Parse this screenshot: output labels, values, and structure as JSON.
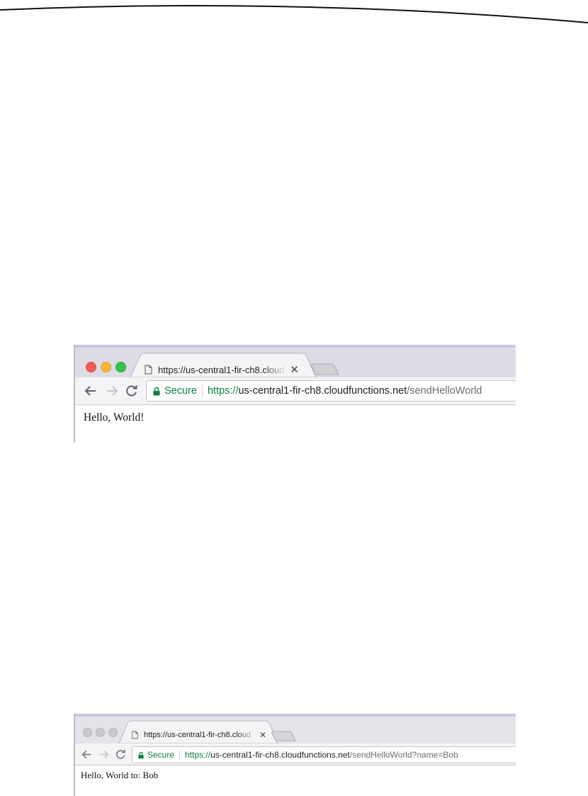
{
  "screenshots": [
    {
      "tab": {
        "title": "https://us-central1-fir-ch8.cloud",
        "close": "✕",
        "icon": "page-icon"
      },
      "address_bar": {
        "secure_label": "Secure",
        "url_scheme": "https://",
        "url_host": "us-central1-fir-ch8.cloudfunctions.net",
        "url_path": "/sendHelloWorld"
      },
      "page": {
        "text": "Hello, World!"
      }
    },
    {
      "tab": {
        "title": "https://us-central1-fir-ch8.cloud",
        "close": "✕",
        "icon": "page-icon"
      },
      "address_bar": {
        "secure_label": "Secure",
        "url_scheme": "https://",
        "url_host": "us-central1-fir-ch8.cloudfunctions.net",
        "url_path": "/sendHelloWorld?name=Bob"
      },
      "page": {
        "text": "Hello, World to: Bob"
      }
    }
  ],
  "colors": {
    "secure_green": "#0b8043",
    "tabstrip": "#dcdce6",
    "traffic_red": "#f25c56",
    "traffic_yellow": "#f6b63a",
    "traffic_green": "#35c34a"
  }
}
